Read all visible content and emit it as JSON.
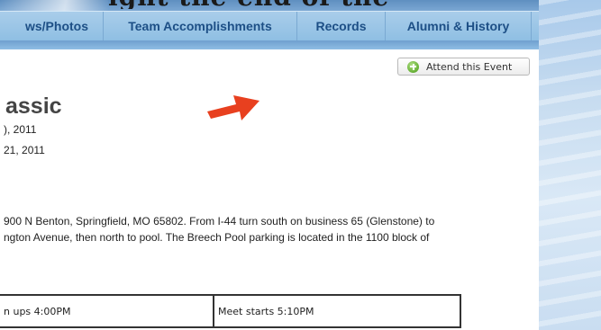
{
  "banner": {
    "partial_text": "ight the end of the"
  },
  "nav": {
    "items": [
      {
        "label": "ws/Photos"
      },
      {
        "label": "Team Accomplishments"
      },
      {
        "label": "Records"
      },
      {
        "label": "Alumni & History"
      }
    ]
  },
  "event": {
    "attend_label": "Attend this Event",
    "title": "assic",
    "date_start": "), 2011",
    "date_end": "21, 2011",
    "location_line1": "900 N Benton, Springfield, MO 65802. From I-44 turn south on business 65 (Glenstone) to",
    "location_line2": "ngton Avenue, then north to pool. The Breech Pool parking is located in the 1100 block of",
    "schedule": {
      "warmups": "n ups 4:00PM",
      "meet_start": "Meet starts 5:10PM"
    }
  },
  "colors": {
    "nav_text": "#1d4f86",
    "arrow": "#e8401f",
    "plus_icon": "#6eb63c"
  },
  "icons": [
    "plus-circle-icon",
    "red-arrow-icon"
  ]
}
